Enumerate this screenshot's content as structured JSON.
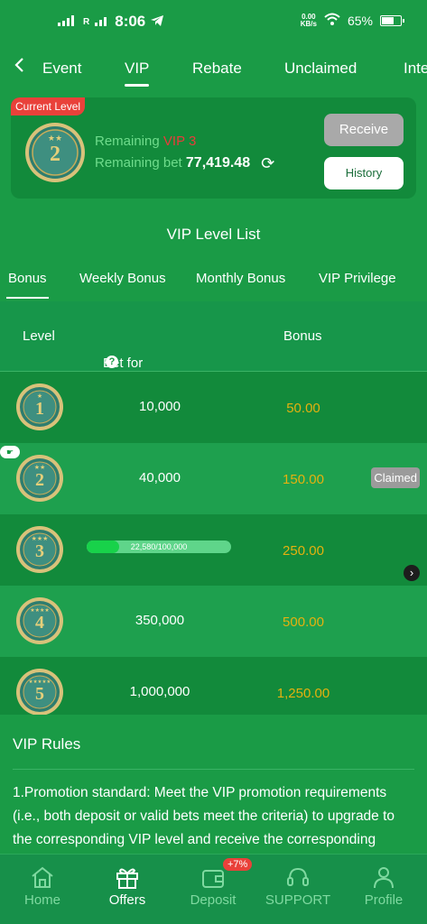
{
  "status_bar": {
    "network": "R",
    "time": "8:06",
    "speed_top": "0.00",
    "speed_bottom": "KB/s",
    "battery": "65%"
  },
  "nav": {
    "tabs": [
      "Event",
      "VIP",
      "Rebate",
      "Unclaimed",
      "Inte"
    ],
    "active": "VIP"
  },
  "vip_card": {
    "badge": "Current Level",
    "level": "2",
    "remaining_label": "Remaining",
    "remaining_vip": "VIP 3",
    "remaining_bet_label": "Remaining bet",
    "remaining_bet": "77,419.48",
    "receive_label": "Receive",
    "history_label": "History"
  },
  "list_title": "VIP Level List",
  "sub_tabs": [
    "Bonus",
    "Weekly Bonus",
    "Monthly Bonus",
    "VIP Privilege"
  ],
  "table": {
    "headers": {
      "level": "Level",
      "bet": "Bet for promotion",
      "help": "?",
      "bonus": "Bonus"
    },
    "rows": [
      {
        "level": "1",
        "bet": "10,000",
        "bonus": "50.00"
      },
      {
        "level": "2",
        "bet": "40,000",
        "bonus": "150.00",
        "status": "Claimed"
      },
      {
        "level": "3",
        "progress_text": "22,580/100,000",
        "progress_fraction": 0.2258,
        "bonus": "250.00"
      },
      {
        "level": "4",
        "bet": "350,000",
        "bonus": "500.00"
      },
      {
        "level": "5",
        "bet": "1,000,000",
        "bonus": "1,250.00"
      }
    ]
  },
  "rules": {
    "title": "VIP Rules",
    "text": "1.Promotion standard: Meet the VIP promotion requirements (i.e., both deposit or valid bets meet the criteria) to upgrade to the corresponding VIP level and receive the corresponding"
  },
  "bottom_nav": {
    "items": [
      "Home",
      "Offers",
      "Deposit",
      "SUPPORT",
      "Profile"
    ],
    "deposit_badge": "+7%",
    "active": "Offers"
  },
  "colors": {
    "background": "#1a9b46",
    "bonus": "#e5b10f",
    "badge_red": "#e9413a"
  }
}
